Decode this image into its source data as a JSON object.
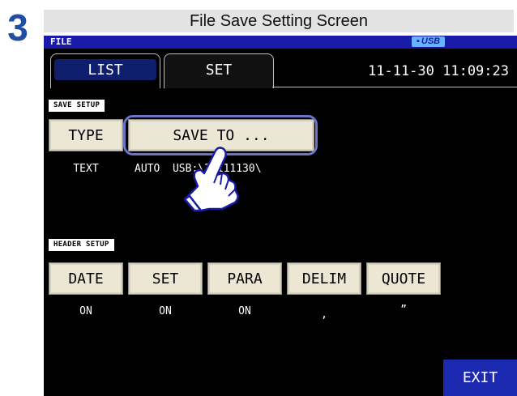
{
  "step_number": "3",
  "caption": "File Save Setting Screen",
  "topbar": {
    "label": "FILE",
    "usb_badge": "USB"
  },
  "tabs": [
    {
      "label": "LIST"
    },
    {
      "label": "SET"
    }
  ],
  "clock": "11-11-30 11:09:23",
  "save_setup": {
    "section_label": "SAVE SETUP",
    "type_button": "TYPE",
    "type_value": "TEXT",
    "save_to_button": "SAVE TO ...",
    "save_to_value": "AUTO  USB:\\20111130\\"
  },
  "header_setup": {
    "section_label": "HEADER SETUP",
    "buttons": [
      {
        "label": "DATE",
        "value": "ON"
      },
      {
        "label": "SET",
        "value": "ON"
      },
      {
        "label": "PARA",
        "value": "ON"
      },
      {
        "label": "DELIM",
        "value": ","
      },
      {
        "label": "QUOTE",
        "value": "”"
      }
    ]
  },
  "exit_button": "EXIT",
  "icons": {
    "hand": "pointing-hand-icon",
    "usb": "usb-icon"
  },
  "colors": {
    "accent": "#1a1aa8",
    "button_face": "#ece6d4",
    "highlight": "#6a74c9",
    "exit": "#1b2ab0"
  }
}
